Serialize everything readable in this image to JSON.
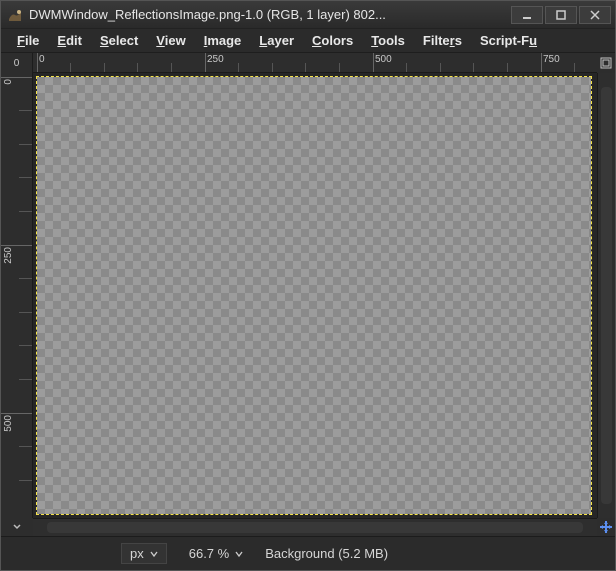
{
  "titlebar": {
    "title": "DWMWindow_ReflectionsImage.png-1.0 (RGB, 1 layer) 802..."
  },
  "menu": {
    "items": [
      {
        "u": "F",
        "rest": "ile"
      },
      {
        "u": "E",
        "rest": "dit"
      },
      {
        "u": "S",
        "rest": "elect"
      },
      {
        "u": "V",
        "rest": "iew"
      },
      {
        "u": "I",
        "rest": "mage"
      },
      {
        "u": "L",
        "rest": "ayer"
      },
      {
        "u": "C",
        "rest": "olors"
      },
      {
        "u": "T",
        "rest": "ools"
      },
      {
        "u": "",
        "rest": "Filte",
        "u2": "r",
        "rest2": "s"
      },
      {
        "u": "",
        "rest": "Script-F",
        "u2": "u",
        "rest2": ""
      }
    ]
  },
  "ruler": {
    "hlabels": [
      "0",
      "250",
      "500",
      "750"
    ],
    "vlabels": [
      "0",
      "250",
      "500"
    ],
    "origin": "0"
  },
  "status": {
    "unit": "px",
    "zoom": "66.7 %",
    "message": "Background (5.2 MB)"
  }
}
